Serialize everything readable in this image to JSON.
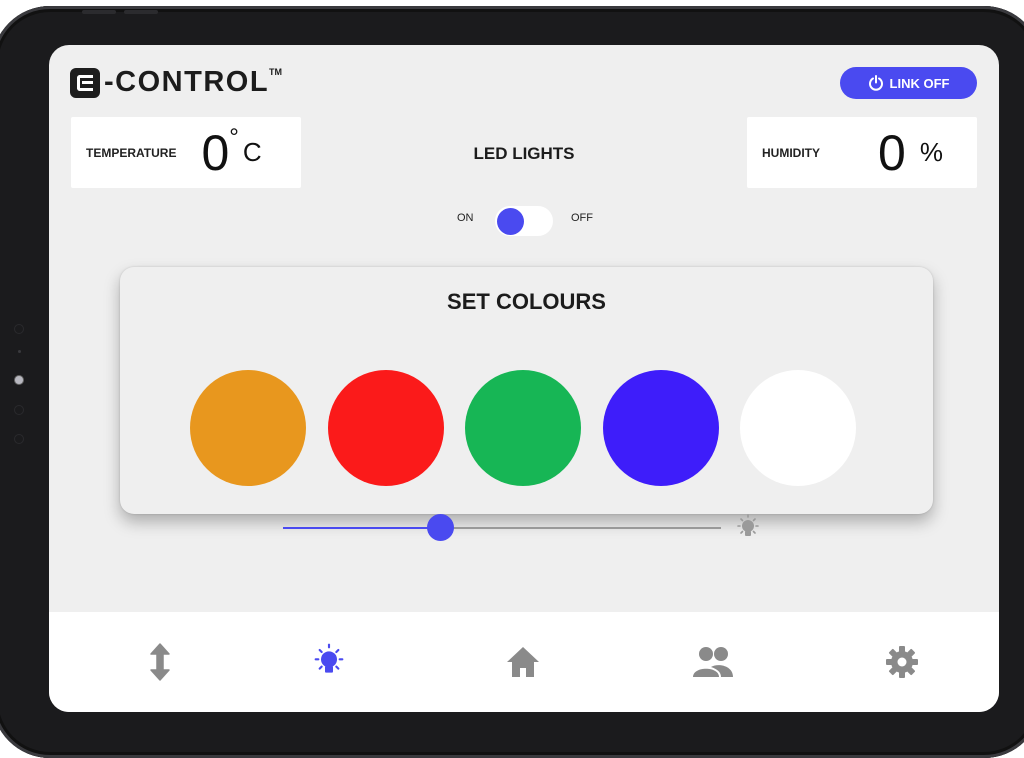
{
  "header": {
    "logo_text": "-CONTROL",
    "logo_tm": "TM",
    "link_button_label": "LINK OFF"
  },
  "temperature": {
    "label": "TEMPERATURE",
    "value": "0",
    "degree": "°",
    "unit": "C"
  },
  "humidity": {
    "label": "HUMIDITY",
    "value": "0",
    "unit": "%"
  },
  "led": {
    "title": "LED LIGHTS",
    "on_label": "ON",
    "off_label": "OFF",
    "state": "ON"
  },
  "colours": {
    "title": "SET COLOURS",
    "swatches": [
      {
        "name": "orange",
        "color": "#e8971e"
      },
      {
        "name": "red",
        "color": "#fb1a1a"
      },
      {
        "name": "green",
        "color": "#17b655"
      },
      {
        "name": "blue",
        "color": "#3e1dfa"
      },
      {
        "name": "white",
        "color": "#ffffff"
      }
    ]
  },
  "brightness": {
    "value_percent": 36,
    "icon": "lightbulb-icon"
  },
  "nav": {
    "items": [
      {
        "icon": "updown-arrow-icon",
        "active": false
      },
      {
        "icon": "lightbulb-icon",
        "active": true
      },
      {
        "icon": "home-icon",
        "active": false
      },
      {
        "icon": "users-icon",
        "active": false
      },
      {
        "icon": "gear-icon",
        "active": false
      }
    ]
  },
  "colors": {
    "accent": "#4a4af0",
    "inactive_icon": "#8a8a8a"
  }
}
